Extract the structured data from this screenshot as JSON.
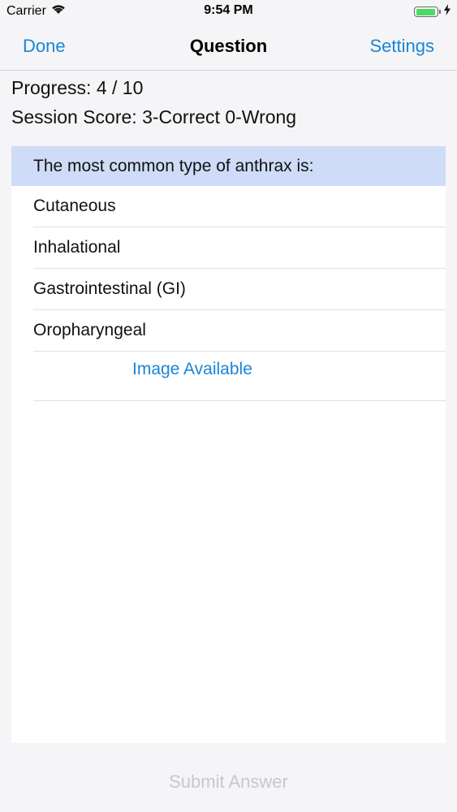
{
  "status_bar": {
    "carrier": "Carrier",
    "time": "9:54 PM"
  },
  "nav": {
    "left_label": "Done",
    "title": "Question",
    "right_label": "Settings"
  },
  "progress_text": "Progress: 4 / 10",
  "score_text": "Session Score: 3-Correct 0-Wrong",
  "question": {
    "text": "The most common type of anthrax is:",
    "answers": [
      "Cutaneous",
      "Inhalational",
      "Gastrointestinal (GI)",
      "Oropharyngeal"
    ],
    "image_link_label": "Image Available"
  },
  "submit_label": "Submit Answer",
  "colors": {
    "accent": "#1a85d6",
    "question_highlight": "#cfdcf7",
    "battery": "#4cd964",
    "disabled_text": "#c8c8cc"
  }
}
